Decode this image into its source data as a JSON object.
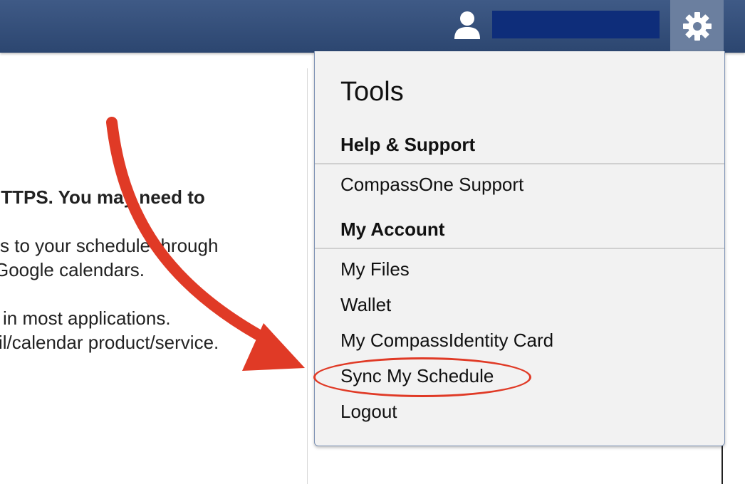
{
  "topbar": {
    "user_icon": "user-icon",
    "gear_icon": "gear-icon",
    "brand_color": "#2c4670"
  },
  "background": {
    "line1": "ITTPS. You may need to",
    "line2": "s to your schedule through",
    "line3": "Google calendars.",
    "line4": "in most applications.",
    "line5": "il/calendar product/service."
  },
  "dropdown": {
    "title": "Tools",
    "sections": [
      {
        "header": "Help & Support",
        "items": [
          {
            "label": "CompassOne Support"
          }
        ]
      },
      {
        "header": "My Account",
        "items": [
          {
            "label": "My Files"
          },
          {
            "label": "Wallet"
          },
          {
            "label": "My CompassIdentity Card"
          },
          {
            "label": "Sync My Schedule"
          },
          {
            "label": "Logout"
          }
        ]
      }
    ]
  },
  "annotation": {
    "color": "#e03a26",
    "arrow_icon": "red-arrow-icon"
  }
}
